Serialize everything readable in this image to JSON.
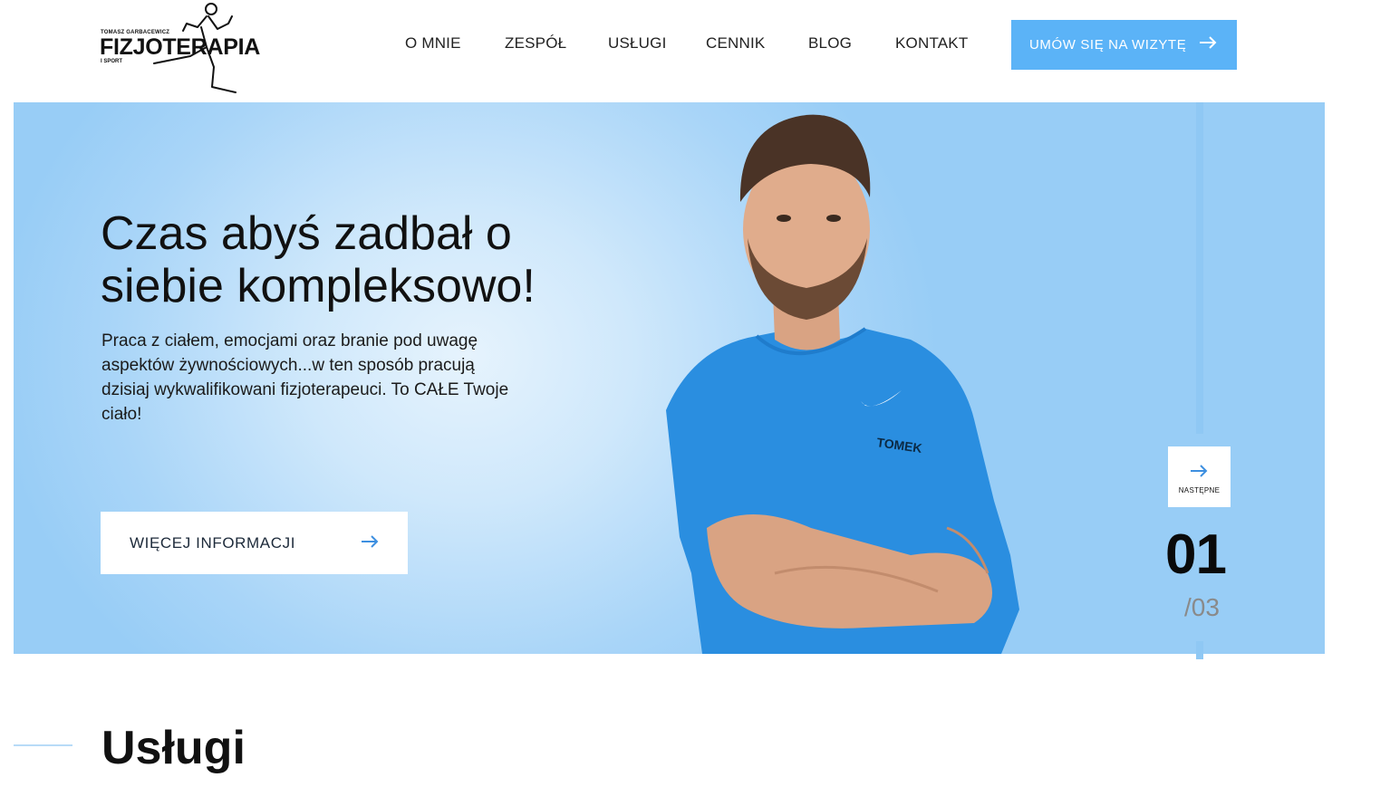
{
  "brand": {
    "top_line": "TOMASZ GARBACEWICZ",
    "name": "FIZJOTERAPIA",
    "sub_line": "I SPORT"
  },
  "nav": {
    "items": [
      {
        "label": "O MNIE"
      },
      {
        "label": "ZESPÓŁ"
      },
      {
        "label": "USŁUGI"
      },
      {
        "label": "CENNIK"
      },
      {
        "label": "BLOG"
      },
      {
        "label": "KONTAKT"
      }
    ],
    "cta_label": "UMÓW SIĘ NA WIZYTĘ",
    "cta_icon": "arrow-right-icon"
  },
  "hero": {
    "title": "Czas abyś zadbał o siebie kompleksowo!",
    "text": "Praca z ciałem, emocjami oraz branie pod uwagę aspektów żywnościowych...w ten sposób pracują dzisiaj wykwalifikowani fizjoterapeuci. To CAŁE Twoje ciało!",
    "button_label": "WIĘCEJ INFORMACJI",
    "shirt_text": "TOMEK"
  },
  "slider": {
    "next_label": "NASTĘPNE",
    "current": "01",
    "total": "/03"
  },
  "section": {
    "title": "Usługi"
  },
  "colors": {
    "accent": "#5bb3f7",
    "hero_bg": "#a9d5f8",
    "shirt": "#2a8ee0"
  }
}
